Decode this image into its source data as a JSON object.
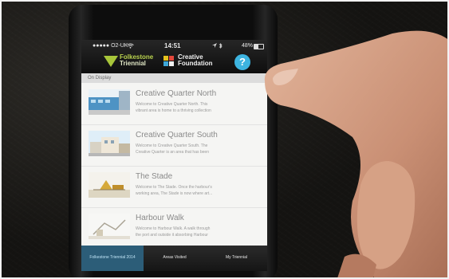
{
  "status_bar": {
    "carrier": "●●●●● O2-UK ",
    "time": "14:51",
    "battery": "48%"
  },
  "header": {
    "logo_left_line1": "Folkestone",
    "logo_left_line2": "Triennial",
    "logo_right_line1": "Creative",
    "logo_right_line2": "Foundation",
    "help_label": "?"
  },
  "section_label": "On Display",
  "items": [
    {
      "title": "Creative Quarter North",
      "desc_line1": "Welcome to Creative Quarter North. This",
      "desc_line2": "vibrant area is home to a thriving collection"
    },
    {
      "title": "Creative Quarter South",
      "desc_line1": "Welcome to Creative Quarter South. The",
      "desc_line2": "Creative Quarter is an area that has been"
    },
    {
      "title": "The Stade",
      "desc_line1": "Welcome to The Stade. Once the harbour's",
      "desc_line2": "working area, The Stade is now where art..."
    },
    {
      "title": "Harbour Walk",
      "desc_line1": "Welcome to Harbour Walk. A walk through",
      "desc_line2": "the port and outside it absorbing Harbour"
    }
  ],
  "tabs": [
    {
      "label": "Folkestone Triennial 2014",
      "active": true
    },
    {
      "label": "Areas Visited",
      "active": false
    },
    {
      "label": "My Triennial",
      "active": false
    }
  ],
  "colors": {
    "accent_green": "#a8c63a",
    "help_blue": "#3db4e0",
    "active_tab": "#2c5d78"
  }
}
